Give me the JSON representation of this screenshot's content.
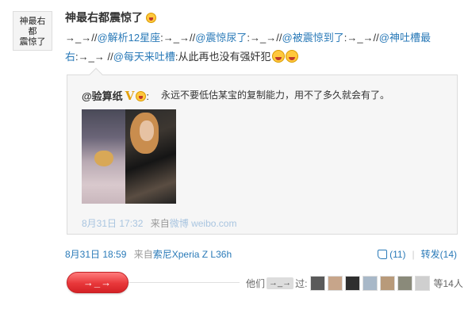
{
  "post": {
    "avatar_text": "神最右\n都\n震惊了",
    "author": "神最右都震惊了",
    "text_segments": [
      {
        "t": "→_→//",
        "link": false
      },
      {
        "t": "@解析12星座",
        "link": true
      },
      {
        "t": ":→_→//",
        "link": false
      },
      {
        "t": "@震惊尿了",
        "link": true
      },
      {
        "t": ":→_→//",
        "link": false
      },
      {
        "t": "@被震惊到了",
        "link": true
      },
      {
        "t": ":→_→//",
        "link": false
      },
      {
        "t": "@神吐槽最右",
        "link": true
      },
      {
        "t": ":→_→ //",
        "link": false
      },
      {
        "t": "@每天来吐槽",
        "link": true
      },
      {
        "t": ":从此再也没有强奸犯",
        "link": false
      }
    ],
    "time": "8月31日 18:59",
    "source_prefix": "来自",
    "source": "索尼Xperia Z L36h",
    "like_label": "(11)",
    "repost_label": "转发(14)"
  },
  "quote": {
    "author": "@验算纸",
    "verified_badge": "V",
    "text": "永远不要低估某宝的复制能力，用不了多久就会有了。",
    "time": "8月31日 17:32",
    "source_prefix": "来自",
    "source": "微博 weibo.com"
  },
  "footer": {
    "button_label": "→_→",
    "others_prefix": "他们",
    "others_chip": "→_→",
    "others_suffix": "过:",
    "face_colors": [
      "#5a5a5a",
      "#c7a58a",
      "#2e2e2e",
      "#a8b8c8",
      "#b89a7a",
      "#8a8a7a",
      "#cfcfcf"
    ],
    "count_label": "等14人"
  },
  "colors": {
    "link": "#2a7ab8",
    "button": "#e8373a",
    "badge": "#e3a10f"
  }
}
